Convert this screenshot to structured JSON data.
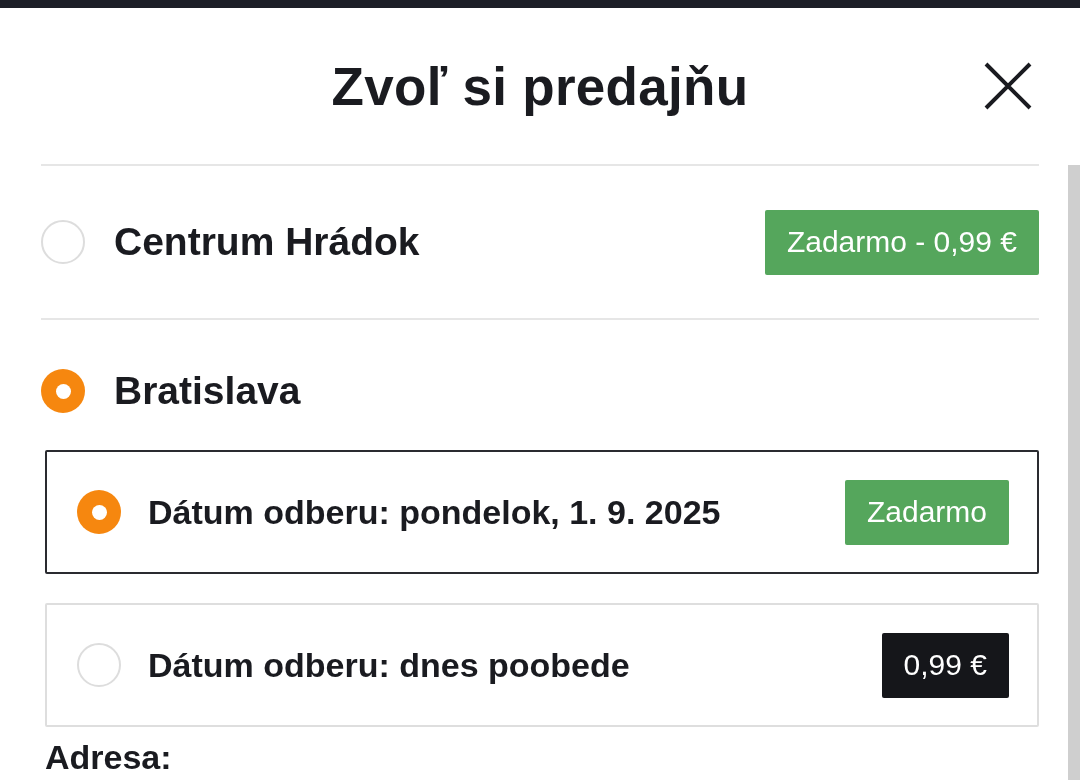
{
  "header": {
    "title": "Zvoľ si predajňu"
  },
  "stores": [
    {
      "name": "Centrum Hrádok",
      "selected": false,
      "price": {
        "text": "Zadarmo - 0,99 €",
        "kind": "free"
      }
    },
    {
      "name": "Bratislava",
      "selected": true,
      "pickup_dates": [
        {
          "label": "Dátum odberu: pondelok, 1. 9. 2025",
          "selected": true,
          "price": {
            "text": "Zadarmo",
            "kind": "free"
          }
        },
        {
          "label": "Dátum odberu: dnes poobede",
          "selected": false,
          "price": {
            "text": "0,99 €",
            "kind": "paid"
          }
        }
      ]
    }
  ],
  "address": {
    "label": "Adresa:"
  }
}
